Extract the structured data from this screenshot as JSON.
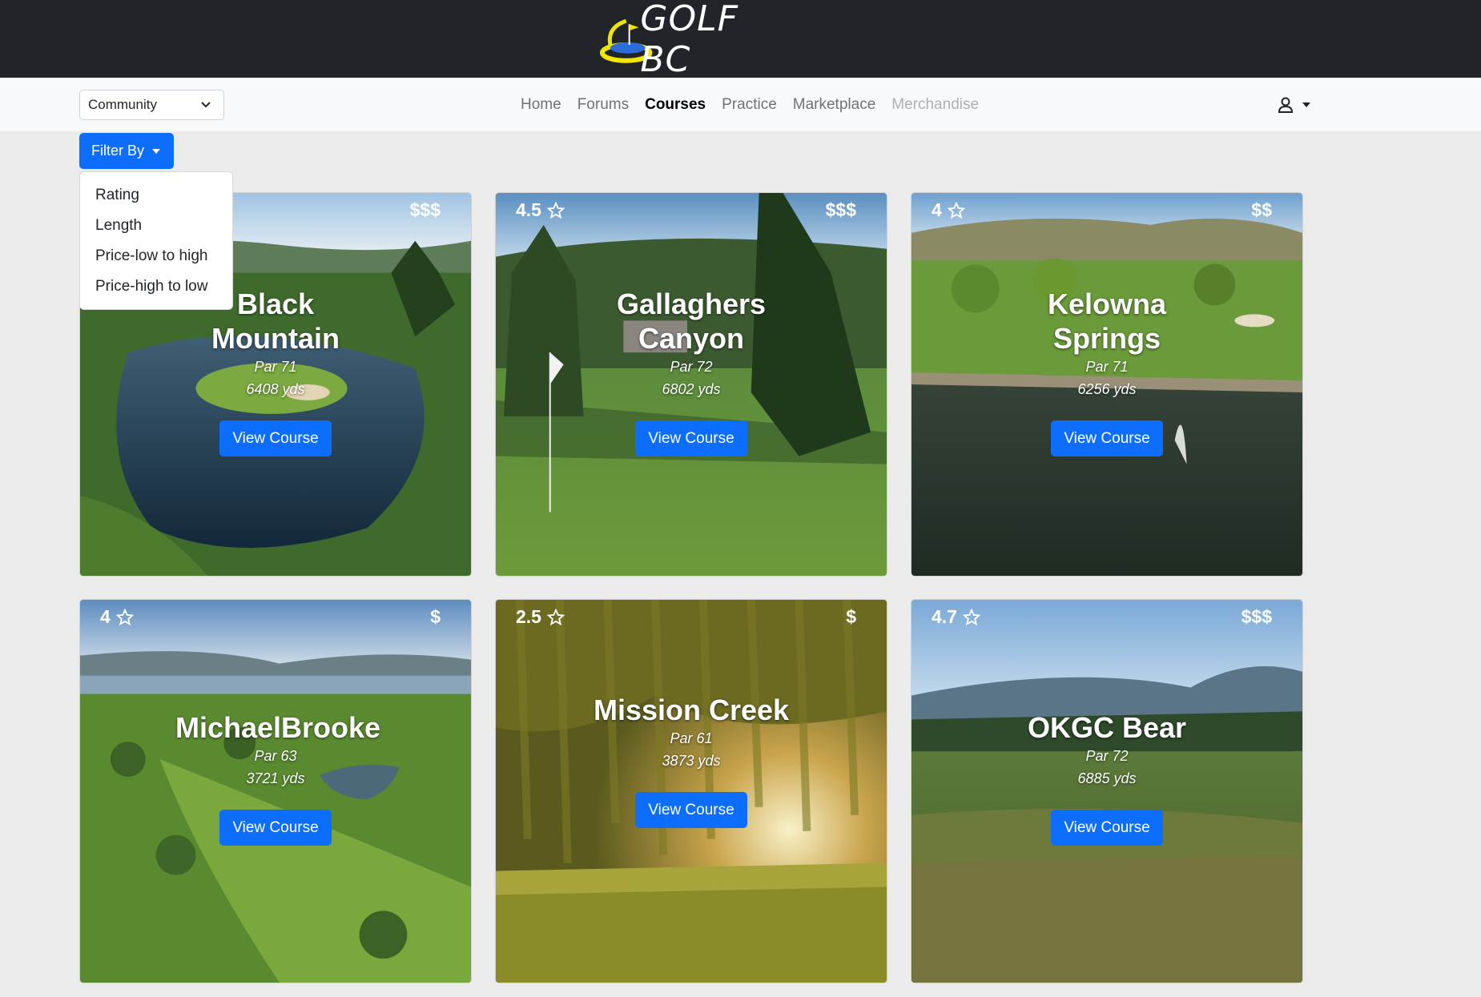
{
  "header": {
    "logo_text": "GOLF BC",
    "logo_icon": "golf-flag-swoosh-icon"
  },
  "navbar": {
    "community_select": {
      "value": "Community"
    },
    "links": [
      "Home",
      "Forums",
      "Courses",
      "Practice",
      "Marketplace",
      "Merchandise"
    ],
    "active_link": "Courses",
    "disabled_link": "Merchandise",
    "user_icon": "user-icon"
  },
  "filter": {
    "button_label": "Filter By",
    "options": [
      "Rating",
      "Length",
      "Price-low to high",
      "Price-high to low"
    ]
  },
  "courses": [
    {
      "name": "Black Mountain",
      "rating": "",
      "price": "$$$",
      "par": "Par 71",
      "yds": "6408 yds",
      "button": "View Course"
    },
    {
      "name": "Gallaghers Canyon",
      "rating": "4.5",
      "price": "$$$",
      "par": "Par 72",
      "yds": "6802 yds",
      "button": "View Course"
    },
    {
      "name": "Kelowna Springs",
      "rating": "4",
      "price": "$$",
      "par": "Par 71",
      "yds": "6256 yds",
      "button": "View Course"
    },
    {
      "name": "MichaelBrooke",
      "rating": "4",
      "price": "$",
      "par": "Par 63",
      "yds": "3721 yds",
      "button": "View Course"
    },
    {
      "name": "Mission Creek",
      "rating": "2.5",
      "price": "$",
      "par": "Par 61",
      "yds": "3873 yds",
      "button": "View Course"
    },
    {
      "name": "OKGC Bear",
      "rating": "4.7",
      "price": "$$$",
      "par": "Par 72",
      "yds": "6885 yds",
      "button": "View Course"
    }
  ],
  "colors": {
    "topbar": "#212529",
    "primary": "#0d6efd",
    "page_bg": "#ebebeb"
  }
}
